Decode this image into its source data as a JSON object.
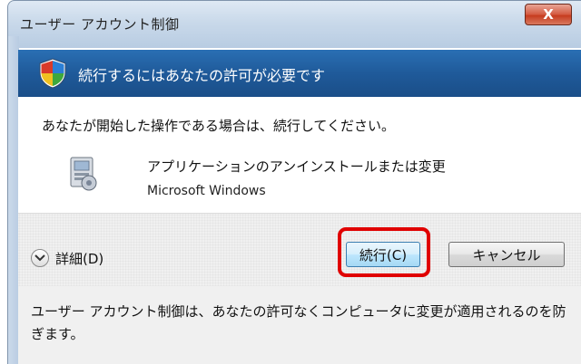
{
  "window": {
    "title": "ユーザー アカウント制御",
    "close_label": "X"
  },
  "header": {
    "text": "続行するにはあなたの許可が必要です",
    "icon": "uac-shield-icon"
  },
  "content": {
    "prompt": "あなたが開始した操作である場合は、続行してください。",
    "program_name": "アプリケーションのアンインストールまたは変更",
    "publisher": "Microsoft Windows",
    "program_icon": "programs-icon"
  },
  "buttons": {
    "details_label": "詳細(D)",
    "continue_label": "続行(C)",
    "cancel_label": "キャンセル"
  },
  "footer": {
    "text": "ユーザー アカウント制御は、あなたの許可なくコンピュータに変更が適用されるのを防ぎます。"
  },
  "colors": {
    "header_band": "#1f5a9a",
    "highlight": "#e00000"
  }
}
